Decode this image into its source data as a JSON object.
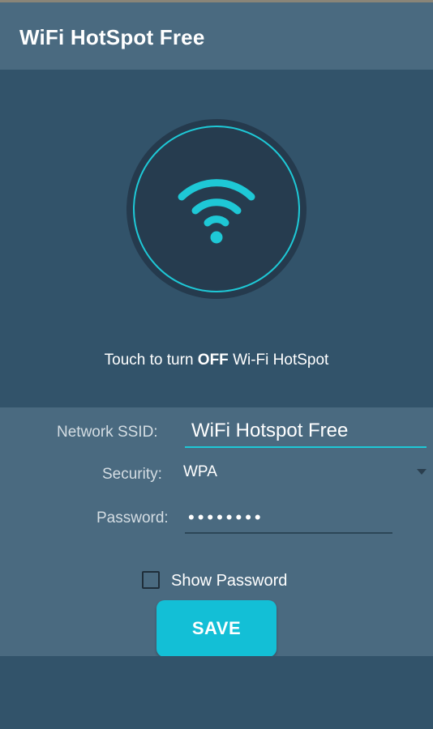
{
  "app": {
    "title": "WiFi HotSpot Free"
  },
  "hotspot": {
    "toggle_icon": "wifi-icon",
    "caption_prefix": "Touch to turn ",
    "caption_state": "OFF",
    "caption_suffix": " Wi-Fi HotSpot"
  },
  "form": {
    "ssid_label": "Network SSID:",
    "ssid_value": "WiFi Hotspot Free",
    "security_label": "Security:",
    "security_value": "WPA",
    "password_label": "Password:",
    "password_masked": "••••••••",
    "show_password_label": "Show Password",
    "show_password_checked": false,
    "save_label": "SAVE"
  },
  "colors": {
    "accent": "#1ec8d6",
    "button": "#13bfd6",
    "toolbar": "#4a6a80",
    "background": "#32536a"
  }
}
